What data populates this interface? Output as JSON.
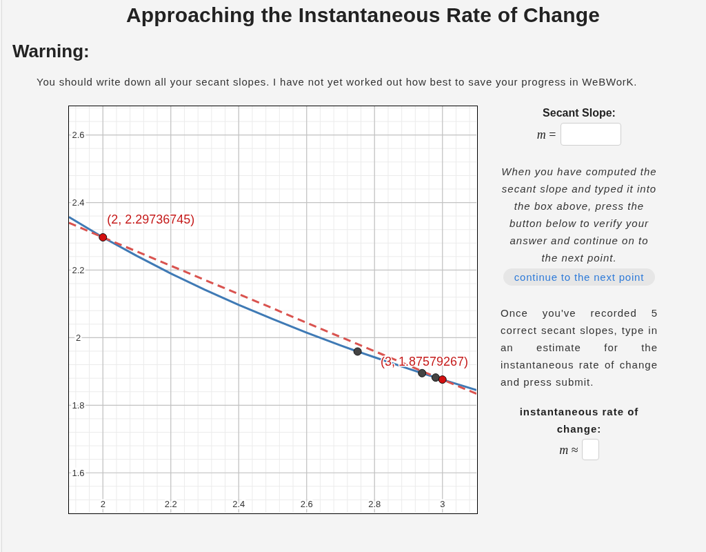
{
  "title": "Approaching the Instantaneous Rate of Change",
  "warning": {
    "heading": "Warning:",
    "text": "You should write down all your secant slopes. I have not yet worked out how best to save your progress in WeBWorK."
  },
  "graph": {
    "chart_data": {
      "type": "line",
      "grid": true,
      "x": [
        1.9,
        2.0,
        2.1,
        2.2,
        2.3,
        2.4,
        2.5,
        2.6,
        2.7,
        2.75,
        2.8,
        2.9,
        2.94,
        2.98,
        3.0,
        3.1
      ],
      "series": [
        {
          "color": "#3f7ab5",
          "line_style": "solid",
          "values": [
            2.357,
            2.297,
            2.242,
            2.19,
            2.142,
            2.097,
            2.055,
            2.015,
            1.977,
            1.959,
            1.942,
            1.908,
            1.895,
            1.882,
            1.876,
            1.845
          ]
        },
        {
          "color": "#d9534f",
          "line_style": "dashed",
          "values": [
            2.34,
            2.297,
            2.255,
            2.213,
            2.171,
            2.129,
            2.087,
            2.044,
            2.002,
            1.981,
            1.96,
            1.918,
            1.901,
            1.884,
            1.876,
            1.834
          ]
        },
        {
          "type": "scatter",
          "color": "#444444",
          "marker": "circle",
          "values": [
            null,
            null,
            null,
            null,
            null,
            null,
            null,
            null,
            null,
            1.959,
            null,
            null,
            1.895,
            1.882,
            null,
            null
          ]
        }
      ],
      "xlim": [
        1.9,
        3.1
      ],
      "ylim": [
        1.482,
        2.685
      ],
      "xticks": [
        2,
        2.2,
        2.4,
        2.6,
        2.8,
        3
      ],
      "yticks": [
        1.6,
        1.8,
        2,
        2.2,
        2.4,
        2.6
      ],
      "annotations": [
        {
          "text": "(2, 2.29736745)",
          "x": 2,
          "y": 2.297
        },
        {
          "text": "(3, 1.87579267)",
          "x": 3,
          "y": 1.876
        }
      ]
    }
  },
  "secant_panel": {
    "heading": "Secant Slope:",
    "label": "*m* =",
    "instructions": "When you have computed the secant slope and typed it into the box above, press the button below to verify your answer and continue on to the next point.",
    "button": "continue to the next point"
  },
  "estimate_panel": {
    "instructions": "Once you've recorded 5 correct secant slopes, type in an estimate for the instantaneous rate of change and press submit.",
    "heading": "instantaneous rate of change:",
    "label": "*m* ≈"
  }
}
